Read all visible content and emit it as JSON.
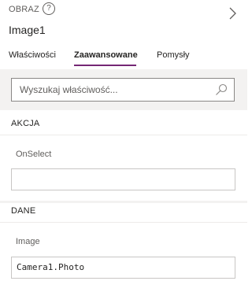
{
  "header": {
    "control_type": "OBRAZ",
    "help_icon_label": "?",
    "control_name": "Image1"
  },
  "tabs": [
    {
      "label": "Właściwości",
      "active": false
    },
    {
      "label": "Zaawansowane",
      "active": true
    },
    {
      "label": "Pomysły",
      "active": false
    }
  ],
  "search": {
    "placeholder": "Wyszukaj właściwość..."
  },
  "sections": {
    "akcja": {
      "title": "AKCJA",
      "properties": [
        {
          "label": "OnSelect",
          "value": ""
        }
      ]
    },
    "dane": {
      "title": "DANE",
      "properties": [
        {
          "label": "Image",
          "value": "Camera1.Photo"
        }
      ]
    }
  },
  "colors": {
    "accent": "#742774",
    "panel_background": "#f3f2f1",
    "border": "#c8c6c4"
  }
}
